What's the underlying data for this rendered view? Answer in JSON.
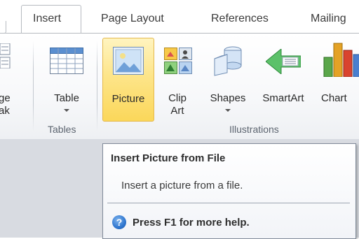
{
  "tabs": [
    {
      "label": "Insert",
      "active": true
    },
    {
      "label": "Page Layout",
      "active": false
    },
    {
      "label": "References",
      "active": false
    },
    {
      "label": "Mailing",
      "active": false
    }
  ],
  "ribbon": {
    "partial_button": {
      "line1": "ge",
      "line2": "ak"
    },
    "tables_group": {
      "label": "Tables",
      "buttons": [
        {
          "label": "Table",
          "has_dropdown": true
        }
      ]
    },
    "illustrations_group": {
      "label": "Illustrations",
      "buttons": [
        {
          "label": "Picture",
          "highlighted": true
        },
        {
          "label_line1": "Clip",
          "label_line2": "Art"
        },
        {
          "label": "Shapes",
          "has_dropdown": true
        },
        {
          "label": "SmartArt"
        },
        {
          "label": "Chart"
        }
      ]
    }
  },
  "tooltip": {
    "title": "Insert Picture from File",
    "description": "Insert a picture from a file.",
    "help_text": "Press F1 for more help.",
    "help_icon_glyph": "?"
  },
  "colors": {
    "highlight": "#fbd75a",
    "ribbon_border": "#b6bac0",
    "background_gray": "#d8dbe1"
  }
}
